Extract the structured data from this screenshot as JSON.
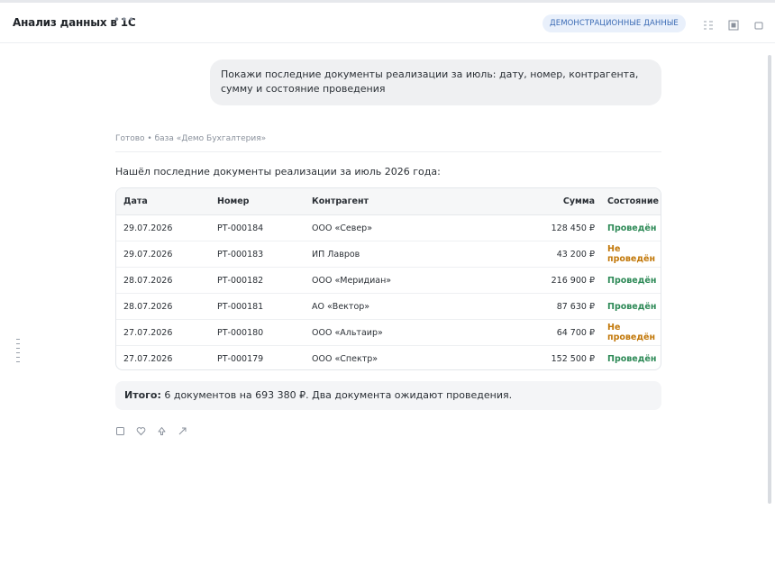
{
  "header": {
    "title": "Анализ данных в 1С",
    "menu_glyph": "•••",
    "badge": "ДЕМОНСТРАЦИОННЫЕ ДАННЫЕ",
    "icons": [
      "list-icon",
      "panel-icon",
      "square-icon"
    ]
  },
  "chat": {
    "user_message": "Покажи последние документы реализации за июль: дату, номер, контрагента, сумму и состояние проведения",
    "status": "Готово • база «Демо Бухгалтерия»",
    "intro": "Нашёл последние документы реализации за июль 2026 года:",
    "table": {
      "columns": [
        "Дата",
        "Номер",
        "Контрагент",
        "Сумма",
        "Состояние"
      ],
      "rows": [
        [
          "29.07.2026",
          "РТ-000184",
          "ООО «Север»",
          "128 450 ₽",
          "Проведён"
        ],
        [
          "29.07.2026",
          "РТ-000183",
          "ИП Лавров",
          "43 200 ₽",
          "Не проведён"
        ],
        [
          "28.07.2026",
          "РТ-000182",
          "ООО «Меридиан»",
          "216 900 ₽",
          "Проведён"
        ],
        [
          "28.07.2026",
          "РТ-000181",
          "АО «Вектор»",
          "87 630 ₽",
          "Проведён"
        ],
        [
          "27.07.2026",
          "РТ-000180",
          "ООО «Альтаир»",
          "64 700 ₽",
          "Не проведён"
        ],
        [
          "27.07.2026",
          "РТ-000179",
          "ООО «Спектр»",
          "152 500 ₽",
          "Проведён"
        ]
      ]
    },
    "summary": {
      "label": "Итого:",
      "text": " 6 документов на 693 380 ₽. Два документа ожидают проведения."
    },
    "actions": [
      "copy-icon",
      "like-icon",
      "dislike-icon",
      "share-icon"
    ]
  },
  "colors": {
    "posted": "#2e8a57",
    "not_posted": "#c2780a",
    "badge_bg": "#e9f0fb",
    "badge_text": "#3b6bb5"
  }
}
